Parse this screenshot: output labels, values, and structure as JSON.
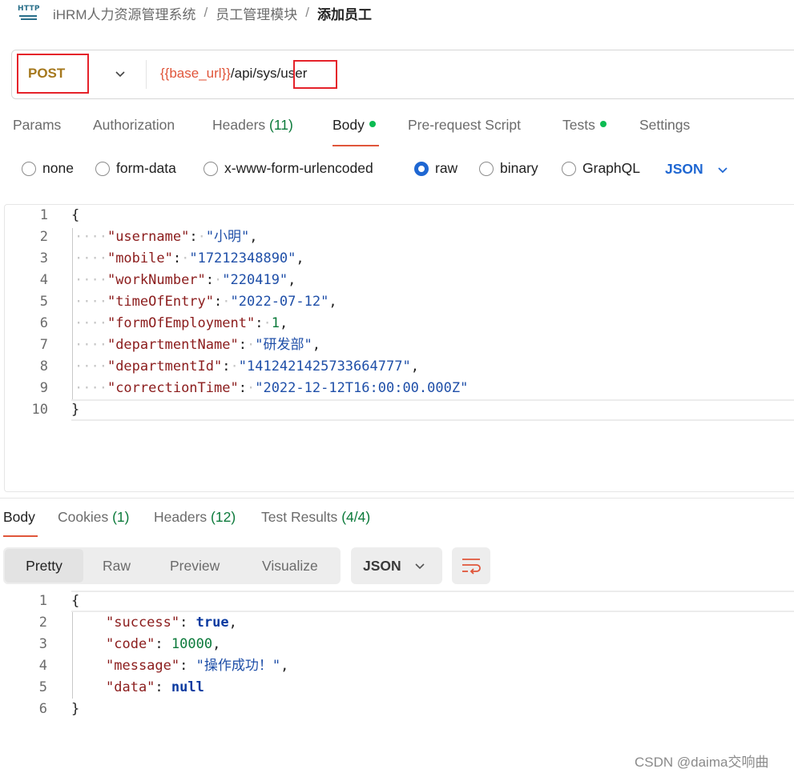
{
  "breadcrumb": {
    "icon_text": "HTTP",
    "items": [
      "iHRM人力资源管理系统",
      "员工管理模块",
      "添加员工"
    ],
    "separator": "/"
  },
  "request": {
    "method": "POST",
    "url_var": "{{base_url}}",
    "url_mid": "/api/sys/",
    "url_end": "user",
    "method_color": "#a5781d",
    "highlight_color": "#e5222a"
  },
  "request_tabs": [
    {
      "label": "Params",
      "count": ""
    },
    {
      "label": "Authorization",
      "count": ""
    },
    {
      "label": "Headers",
      "count": "(11)"
    },
    {
      "label": "Body",
      "count": ""
    },
    {
      "label": "Pre-request Script",
      "count": ""
    },
    {
      "label": "Tests",
      "count": ""
    },
    {
      "label": "Settings",
      "count": ""
    }
  ],
  "body_types": {
    "options": [
      "none",
      "form-data",
      "x-www-form-urlencoded",
      "raw",
      "binary",
      "GraphQL"
    ],
    "selected": "raw",
    "language": "JSON"
  },
  "request_body": {
    "line_numbers": [
      "1",
      "2",
      "3",
      "4",
      "5",
      "6",
      "7",
      "8",
      "9",
      "10"
    ],
    "open_brace": "{",
    "close_brace": "}",
    "fields": [
      {
        "key": "\"username\"",
        "value": "\"小明\"",
        "comma": ","
      },
      {
        "key": "\"mobile\"",
        "value": "\"17212348890\"",
        "comma": ","
      },
      {
        "key": "\"workNumber\"",
        "value": "\"220419\"",
        "comma": ","
      },
      {
        "key": "\"timeOfEntry\"",
        "value": "\"2022-07-12\"",
        "comma": ","
      },
      {
        "key": "\"formOfEmployment\"",
        "value": "1",
        "comma": ","
      },
      {
        "key": "\"departmentName\"",
        "value": "\"研发部\"",
        "comma": ","
      },
      {
        "key": "\"departmentId\"",
        "value": "\"1412421425733664777\"",
        "comma": ","
      },
      {
        "key": "\"correctionTime\"",
        "value": "\"2022-12-12T16:00:00.000Z\"",
        "comma": ""
      }
    ]
  },
  "response_tabs": [
    {
      "label": "Body",
      "count": ""
    },
    {
      "label": "Cookies",
      "count": "(1)"
    },
    {
      "label": "Headers",
      "count": "(12)"
    },
    {
      "label": "Test Results",
      "count": "(4/4)"
    }
  ],
  "response_views": [
    "Pretty",
    "Raw",
    "Preview",
    "Visualize"
  ],
  "response_format": "JSON",
  "response_body": {
    "line_numbers": [
      "1",
      "2",
      "3",
      "4",
      "5",
      "6"
    ],
    "open_brace": "{",
    "close_brace": "}",
    "fields": [
      {
        "key": "\"success\"",
        "value": "true",
        "comma": ","
      },
      {
        "key": "\"code\"",
        "value": "10000",
        "comma": ","
      },
      {
        "key": "\"message\"",
        "value": "\"操作成功！\"",
        "comma": ","
      },
      {
        "key": "\"data\"",
        "value": "null",
        "comma": ""
      }
    ]
  },
  "watermark": "CSDN @daima交响曲",
  "colors": {
    "accent_orange": "#e0553a",
    "active_blue": "#1f67d2",
    "status_green": "#0cbb52",
    "json_key": "#8b1c1c",
    "json_string": "#1f4fa8",
    "json_number": "#0c7a3b"
  }
}
